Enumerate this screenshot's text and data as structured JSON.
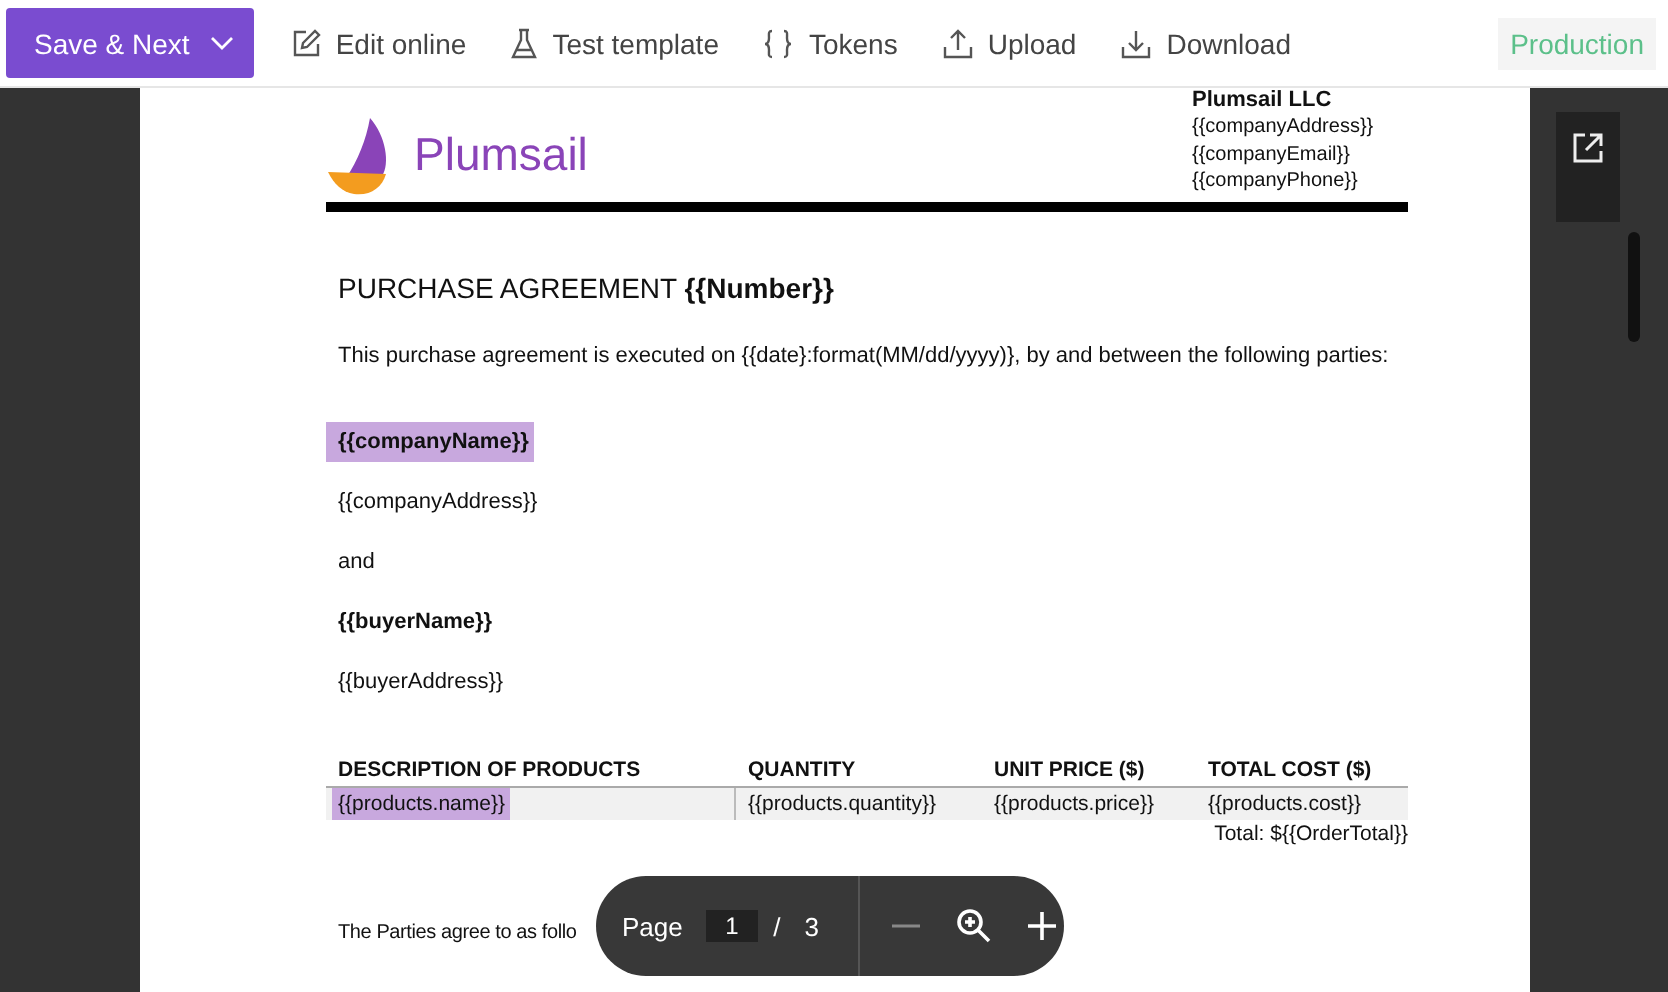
{
  "toolbar": {
    "primary_button": {
      "label": "Save & Next"
    },
    "actions": [
      {
        "kind": "edit",
        "label": "Edit online"
      },
      {
        "kind": "test",
        "label": "Test template"
      },
      {
        "kind": "tokens",
        "label": "Tokens"
      },
      {
        "kind": "upload",
        "label": "Upload"
      },
      {
        "kind": "download",
        "label": "Download"
      }
    ],
    "status_badge": "Production"
  },
  "document": {
    "logo_text": "Plumsail",
    "company_name": "Plumsail LLC",
    "header_lines": [
      "{{companyAddress}}",
      "{{companyEmail}}",
      "{{companyPhone}}"
    ],
    "title": "PURCHASE AGREEMENT **{{Number}}**",
    "intro": "This purchase agreement is executed on {{date}:format(MM/dd/yyyy)}, by and between the following parties:",
    "parties": [
      {
        "text": "{{companyName}}",
        "bold": true,
        "highlighted": true
      },
      {
        "text": "{{companyAddress}}",
        "bold": false,
        "highlighted": false
      },
      {
        "text": "and",
        "bold": false,
        "highlighted": false
      },
      {
        "text": "{{buyerName}}",
        "bold": true,
        "highlighted": false
      },
      {
        "text": "{{buyerAddress}}",
        "bold": false,
        "highlighted": false
      }
    ],
    "table": {
      "columns": [
        "DESCRIPTION OF PRODUCTS",
        "QUANTITY",
        "UNIT PRICE ($)",
        "TOTAL COST ($)"
      ],
      "rows": [
        [
          {
            "text": "{{products.name}}",
            "highlighted": true
          },
          {
            "text": "{{products.quantity}}",
            "highlighted": false
          },
          {
            "text": "{{products.price}}",
            "highlighted": false
          },
          {
            "text": "{{products.cost}}",
            "highlighted": false
          }
        ]
      ],
      "total": "Total: ${{OrderTotal}}"
    },
    "closing": "The Parties agree to as follo"
  },
  "pager": {
    "label": "Page",
    "current": "1",
    "separator": "/",
    "total": "3"
  }
}
